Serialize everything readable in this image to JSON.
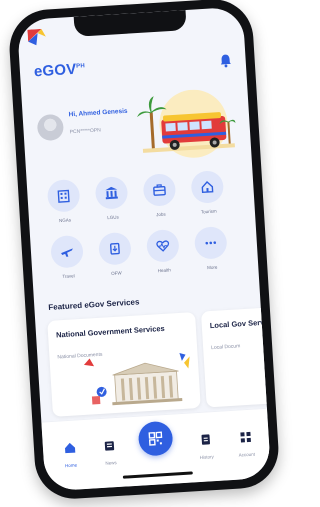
{
  "app": {
    "logo_main": "eGOV",
    "logo_sup": "PH"
  },
  "profile": {
    "greeting": "Hi, Ahmed Genesis",
    "id_text": "PCN*****OPN"
  },
  "services": [
    {
      "label": "NGAs",
      "icon": "building-icon"
    },
    {
      "label": "LGUs",
      "icon": "city-hall-icon"
    },
    {
      "label": "Jobs",
      "icon": "briefcase-icon"
    },
    {
      "label": "Tourism",
      "icon": "house-icon"
    },
    {
      "label": "Travel",
      "icon": "plane-icon"
    },
    {
      "label": "OFW",
      "icon": "passport-icon"
    },
    {
      "label": "Health",
      "icon": "heart-pulse-icon"
    },
    {
      "label": "More",
      "icon": "more-icon"
    }
  ],
  "featured": {
    "title": "Featured eGov Services",
    "cards": [
      {
        "title": "National Government Services",
        "subtitle": "National Documents"
      },
      {
        "title": "Local Gov Services",
        "subtitle": "Local Docum"
      }
    ]
  },
  "tabs": [
    {
      "label": "Home",
      "icon": "home-icon",
      "active": true
    },
    {
      "label": "News",
      "icon": "news-icon"
    },
    {
      "label": "Scan",
      "icon": "qr-scan-icon"
    },
    {
      "label": "History",
      "icon": "history-icon"
    },
    {
      "label": "Account",
      "icon": "grid-icon"
    }
  ],
  "colors": {
    "accent": "#2f5fe0",
    "icon_bg": "#dfe6fa",
    "text_dark": "#1b2346",
    "text_muted": "#8a90a6"
  }
}
